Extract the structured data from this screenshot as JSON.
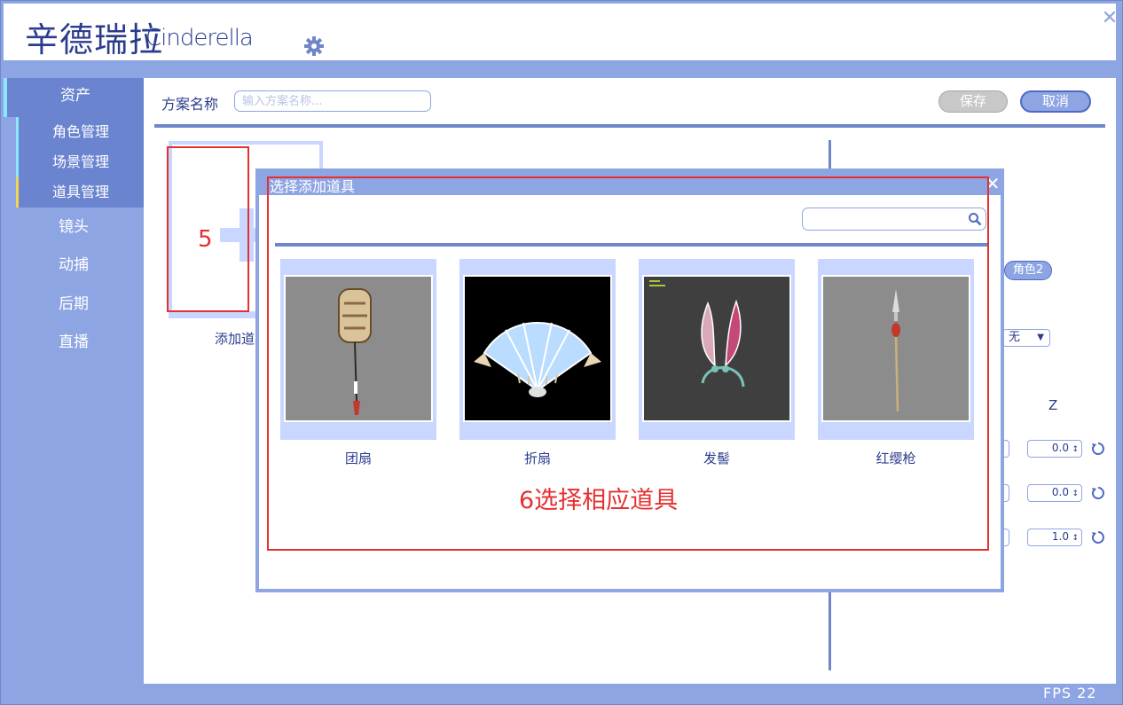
{
  "header": {
    "brand_cn": "辛德瑞拉",
    "brand_en": "Cinderella",
    "settings_icon": "gear-icon",
    "close_icon": "close-icon",
    "close_glyph": "✕"
  },
  "sidebar": {
    "assets": "资产",
    "sub_items": [
      "角色管理",
      "场景管理",
      "道具管理"
    ],
    "items": [
      "镜头",
      "动捕",
      "后期",
      "直播"
    ]
  },
  "toolbar": {
    "scheme_label": "方案名称",
    "scheme_placeholder": "输入方案名称...",
    "save_label": "保存",
    "cancel_label": "取消"
  },
  "add_prop": {
    "label": "添加道具"
  },
  "right_panel": {
    "role_chip": "角色2",
    "select_value": "无",
    "z_label": "Z",
    "values": [
      "0.0",
      "0.0",
      "1.0"
    ]
  },
  "modal": {
    "title": "选择添加道具",
    "close_glyph": "✕",
    "search_placeholder": "",
    "items": [
      {
        "label": "团扇",
        "bg": "#8c8c8c"
      },
      {
        "label": "折扇",
        "bg": "#000000"
      },
      {
        "label": "发髻",
        "bg": "#3f3f3f"
      },
      {
        "label": "红缨枪",
        "bg": "#8c8c8c"
      }
    ]
  },
  "annotations": {
    "step5": "5",
    "step6": "6选择相应道具"
  },
  "footer": {
    "fps": "FPS 22"
  },
  "colors": {
    "accent": "#8ea5e4",
    "accent_dark": "#6f86c9",
    "text": "#2b3c8c",
    "annotation": "#e53030"
  }
}
